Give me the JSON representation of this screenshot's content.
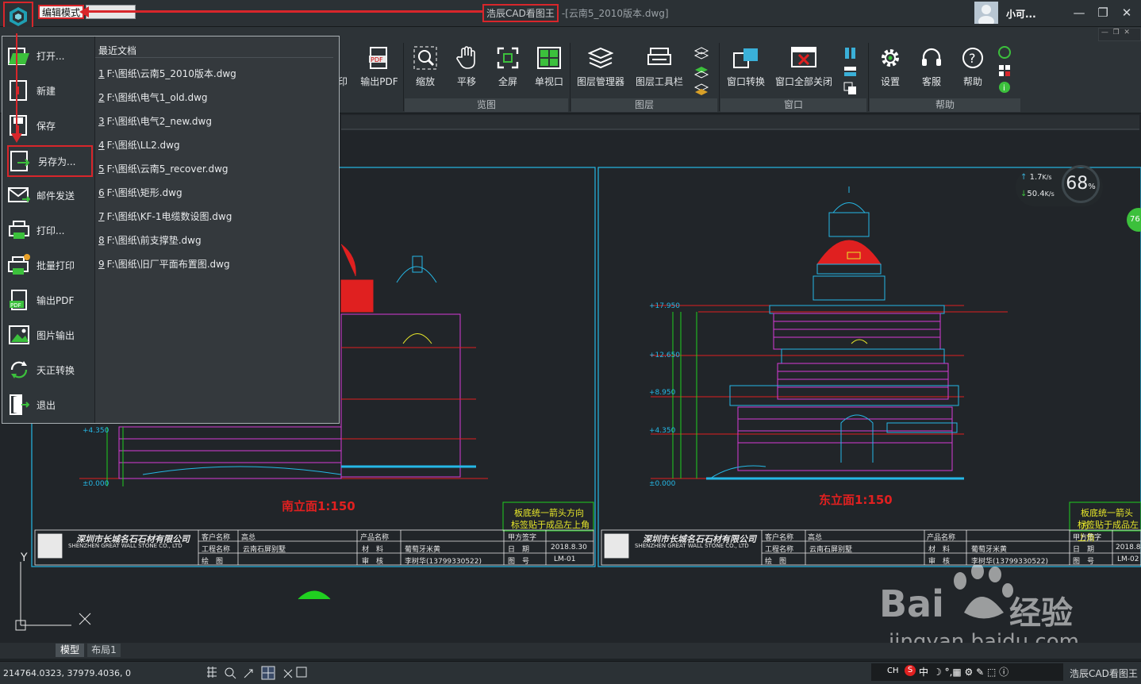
{
  "titlebar": {
    "mode_label": "编辑模式",
    "app_title": "浩辰CAD看图王",
    "doc_title": "-[云南5_2010版本.dwg]",
    "username": "小可...",
    "window_controls": {
      "minimize": "—",
      "restore": "❐",
      "close": "✕"
    }
  },
  "ribbon": {
    "partial_print": "印",
    "buttons": [
      {
        "label": "输出PDF",
        "icon": "pdf-export-icon"
      },
      {
        "label": "缩放",
        "icon": "zoom-icon"
      },
      {
        "label": "平移",
        "icon": "pan-hand-icon"
      },
      {
        "label": "全屏",
        "icon": "fullscreen-icon"
      },
      {
        "label": "单视口",
        "icon": "single-viewport-icon"
      },
      {
        "label": "图层管理器",
        "icon": "layer-manager-icon"
      },
      {
        "label": "图层工具栏",
        "icon": "layer-toolbar-icon"
      },
      {
        "label": "窗口转换",
        "icon": "window-switch-icon"
      },
      {
        "label": "窗口全部关闭",
        "icon": "close-all-windows-icon"
      },
      {
        "label": "设置",
        "icon": "settings-gear-icon"
      },
      {
        "label": "客服",
        "icon": "headset-icon"
      },
      {
        "label": "帮助",
        "icon": "help-icon"
      }
    ],
    "groups": [
      "览图",
      "图层",
      "窗口",
      "帮助"
    ]
  },
  "menu": {
    "items": [
      {
        "label": "打开...",
        "icon": "open-folder-icon"
      },
      {
        "label": "新建",
        "icon": "new-file-icon"
      },
      {
        "label": "保存",
        "icon": "save-icon"
      },
      {
        "label": "另存为...",
        "icon": "save-as-icon"
      },
      {
        "label": "邮件发送",
        "icon": "email-icon"
      },
      {
        "label": "打印...",
        "icon": "print-icon"
      },
      {
        "label": "批量打印",
        "icon": "batch-print-icon"
      },
      {
        "label": "输出PDF",
        "icon": "pdf-icon"
      },
      {
        "label": "图片输出",
        "icon": "image-export-icon"
      },
      {
        "label": "天正转换",
        "icon": "tangent-convert-icon"
      },
      {
        "label": "退出",
        "icon": "exit-icon"
      }
    ],
    "recent_title": "最近文档",
    "recent": [
      {
        "num": "1",
        "path": "F:\\图纸\\云南5_2010版本.dwg"
      },
      {
        "num": "2",
        "path": "F:\\图纸\\电气1_old.dwg"
      },
      {
        "num": "3",
        "path": "F:\\图纸\\电气2_new.dwg"
      },
      {
        "num": "4",
        "path": "F:\\图纸\\LL2.dwg"
      },
      {
        "num": "5",
        "path": "F:\\图纸\\云南5_recover.dwg"
      },
      {
        "num": "6",
        "path": "F:\\图纸\\矩形.dwg"
      },
      {
        "num": "7",
        "path": "F:\\图纸\\KF-1电缆数设图.dwg"
      },
      {
        "num": "8",
        "path": "F:\\图纸\\前支撑垫.dwg"
      },
      {
        "num": "9",
        "path": "F:\\图纸\\旧厂平面布置图.dwg"
      }
    ]
  },
  "speed": {
    "up": "1.7",
    "up_unit": "K/s",
    "down": "50.4",
    "down_unit": "K/s",
    "percent": "68",
    "percent_unit": "%",
    "edge_badge": "76"
  },
  "drawing": {
    "left_caption": "南立面1:150",
    "right_caption": "东立面1:150",
    "note_line1": "板底统一箭头方向",
    "note_line1_right": "板底统一箭头方",
    "note_line2": "标签贴于成品左上角",
    "company_cn": "深圳市长城名石石材有限公司",
    "company_en": "SHENZHEN GREAT WALL STONE CO., LTD",
    "tb_client": "客户名称",
    "tb_client_val": "高总",
    "tb_project": "工程名称",
    "tb_project_val": "云南石屏别墅",
    "tb_drawer": "绘　图",
    "tb_product": "产品名称",
    "tb_material": "材　料",
    "tb_material_val": "葡萄牙米黄",
    "tb_review": "审　核",
    "tb_reviewer": "李树华(13799330522)",
    "tb_sign": "甲方签字",
    "tb_date": "日　期",
    "tb_date_val": "2018.8.30",
    "tb_date_val_right": "2018.8",
    "tb_sheet": "图　号",
    "tb_sheet_left": "LM-01",
    "tb_sheet_right": "LM-02",
    "elev_labels": [
      "+17.950",
      "+12.650",
      "+8.950",
      "+4.350",
      "±0.000"
    ],
    "axis_y": "Y"
  },
  "tabs": {
    "model": "模型",
    "layout": "布局1"
  },
  "status": {
    "coords": "214764.0323, 37979.4036, 0",
    "tray_lang": "CH",
    "tray_ime": "中",
    "tray_app": "浩辰CAD看图王"
  },
  "watermark": {
    "brand": "Bai",
    "brand2": "经验",
    "url": "jingyan.baidu.com"
  },
  "colors": {
    "highlight": "#d8262b",
    "cad_cyan": "#25b8e6",
    "cad_magenta": "#d83ad8",
    "cad_red": "#e02020",
    "cad_green": "#20d020",
    "cad_yellow": "#e8e82a",
    "menu_bg": "#2f3539"
  }
}
